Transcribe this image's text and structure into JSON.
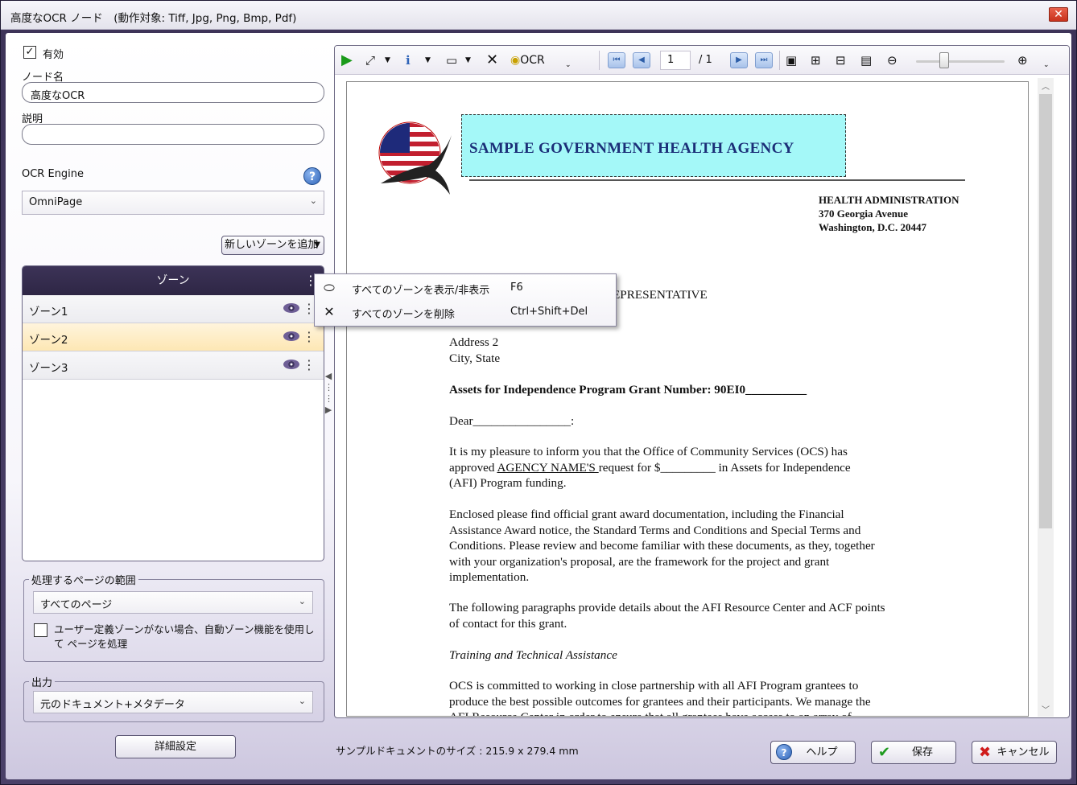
{
  "window": {
    "title": "高度なOCR ノード　(動作対象: Tiff, Jpg, Png, Bmp, Pdf)",
    "close": "✕"
  },
  "left": {
    "enabled_label": "有効",
    "enabled_checked": true,
    "node_name_label": "ノード名",
    "node_name_value": "高度なOCR",
    "description_label": "説明",
    "description_value": "",
    "ocr_engine_label": "OCR Engine",
    "ocr_engine_value": "OmniPage",
    "add_zone_label": "新しいゾーンを追加",
    "zone_header": "ゾーン",
    "zones": [
      "ゾーン1",
      "ゾーン2",
      "ゾーン3"
    ],
    "selected_zone": "ゾーン2",
    "page_range_legend": "処理するページの範囲",
    "page_range_value": "すべてのページ",
    "auto_zone_label": "ユーザー定義ゾーンがない場合、自動ゾーン機能を使用して ページを処理",
    "output_legend": "出力",
    "output_value": "元のドキュメント+メタデータ",
    "advanced_button": "詳細設定"
  },
  "context_menu": {
    "items": [
      {
        "label": "すべてのゾーンを表示/非表示",
        "shortcut": "F6"
      },
      {
        "label": "すべてのゾーンを削除",
        "shortcut": "Ctrl+Shift+Del"
      }
    ]
  },
  "viewer": {
    "ocr_label": "OCR",
    "page_current": "1",
    "page_total": "/ 1",
    "zoom_level": 0.3
  },
  "document": {
    "agency": "SAMPLE GOVERNMENT HEALTH AGENCY",
    "addr1": "HEALTH ADMINISTRATION",
    "addr2": "370 Georgia Avenue",
    "addr3": "Washington, D.C. 20447",
    "rep": "EPRESENTATIVE",
    "address2": "Address 2",
    "city": "City, State",
    "grant_line": "Assets for Independence Program Grant Number:  90EI0__________",
    "dear": "Dear________________:",
    "para1_a": "It is my pleasure to inform you that the Office of Community Services (OCS) has",
    "para1_b_pre": "approved ",
    "para1_b_agency": "AGENCY NAME'S ",
    "para1_b_post": " request for $_________ in Assets for Independence",
    "para1_c": "(AFI) Program funding.",
    "para2_a": "Enclosed please find official grant award documentation, including the Financial",
    "para2_b": "Assistance Award notice, the Standard Terms and Conditions and Special Terms and",
    "para2_c": "Conditions.  Please review and become familiar with these documents, as they, together",
    "para2_d": "with your organization's proposal, are the framework for the project and grant",
    "para2_e": "implementation.",
    "para3_a": "The following paragraphs provide details about the AFI Resource Center and ACF points",
    "para3_b": "of contact for this grant.",
    "heading": "Training and Technical Assistance",
    "para4_a": "OCS is committed to working in close partnership with all AFI Program grantees to",
    "para4_b": "produce the best possible outcomes for grantees and their participants.  We manage the",
    "para4_c": "AFI Resource Center in order to ensure that all grantees have access to an array of"
  },
  "footer": {
    "size_text": "サンプルドキュメントのサイズ : 215.9 x 279.4 mm",
    "help": "ヘルプ",
    "save": "保存",
    "cancel": "キャンセル"
  }
}
